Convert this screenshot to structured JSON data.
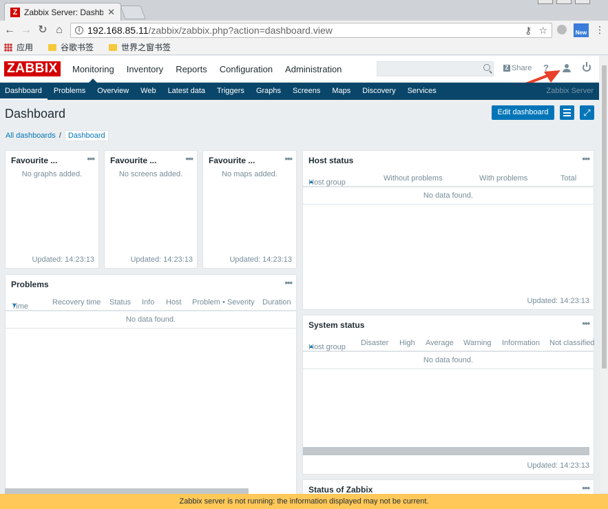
{
  "browser": {
    "tab_title": "Zabbix Server: Dashboa",
    "favicon_letter": "Z",
    "url_host": "192.168.85.11",
    "url_path": "/zabbix/zabbix.php?action=dashboard.view",
    "extension_label": "New",
    "bookmarks": [
      "应用",
      "谷歌书签",
      "世界之窗书签"
    ]
  },
  "header": {
    "logo": "ZABBIX",
    "menu": [
      "Monitoring",
      "Inventory",
      "Reports",
      "Configuration",
      "Administration"
    ],
    "search_placeholder": "",
    "share_label": "Share",
    "help_label": "?"
  },
  "submenu": {
    "items": [
      "Dashboard",
      "Problems",
      "Overview",
      "Web",
      "Latest data",
      "Triggers",
      "Graphs",
      "Screens",
      "Maps",
      "Discovery",
      "Services"
    ],
    "server_name": "Zabbix Server"
  },
  "page": {
    "title": "Dashboard",
    "edit_button": "Edit dashboard",
    "breadcrumb": [
      "All dashboards",
      "Dashboard"
    ]
  },
  "widgets": {
    "fav_graphs": {
      "title": "Favourite ...",
      "empty": "No graphs added.",
      "updated": "Updated: 14:23:13"
    },
    "fav_screens": {
      "title": "Favourite ...",
      "empty": "No screens added.",
      "updated": "Updated: 14:23:13"
    },
    "fav_maps": {
      "title": "Favourite ...",
      "empty": "No maps added.",
      "updated": "Updated: 14:23:13"
    },
    "host_status": {
      "title": "Host status",
      "columns": [
        "Host group",
        "Without problems",
        "With problems",
        "Total"
      ],
      "empty": "No data found.",
      "updated": "Updated: 14:23:13"
    },
    "problems": {
      "title": "Problems",
      "columns": [
        "Time",
        "Recovery time",
        "Status",
        "Info",
        "Host",
        "Problem • Severity",
        "Duration"
      ],
      "empty": "No data found."
    },
    "system_status": {
      "title": "System status",
      "columns": [
        "Host group",
        "Disaster",
        "High",
        "Average",
        "Warning",
        "Information",
        "Not classified"
      ],
      "empty": "No data found.",
      "updated": "Updated: 14:23:13"
    },
    "status_of_zabbix": {
      "title": "Status of Zabbix"
    }
  },
  "warning": "Zabbix server is not running: the information displayed may not be current.",
  "colors": {
    "brand": "#d40000",
    "nav": "#0a466a",
    "button": "#0275b8",
    "warning": "#ffc859",
    "annotation_arrow": "#e8402a"
  }
}
